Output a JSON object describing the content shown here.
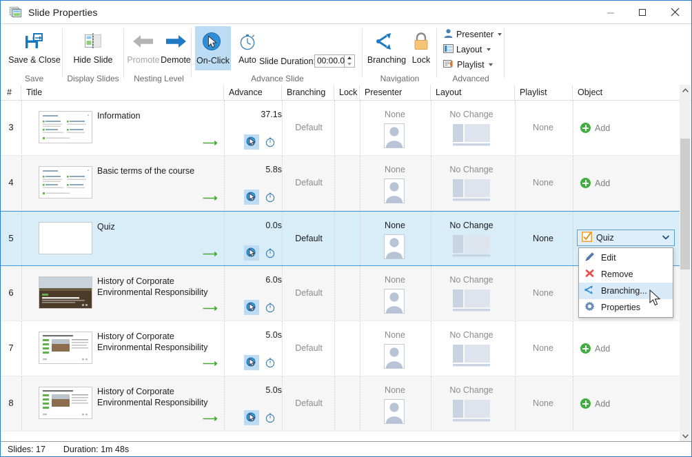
{
  "window": {
    "title": "Slide Properties",
    "icon": "slides-icon",
    "minimize": "minimize-button",
    "maximize": "maximize-button",
    "close": "close-button"
  },
  "ribbon": {
    "groups": [
      {
        "name": "Save",
        "label": "Save"
      },
      {
        "name": "Display Slides",
        "label": "Display Slides"
      },
      {
        "name": "Nesting Level",
        "label": "Nesting Level"
      },
      {
        "name": "Advance Slide",
        "label": "Advance Slide"
      },
      {
        "name": "Navigation",
        "label": "Navigation"
      },
      {
        "name": "Advanced",
        "label": "Advanced"
      }
    ],
    "save_close": "Save & Close",
    "hide_slide": "Hide Slide",
    "promote": "Promote",
    "demote": "Demote",
    "on_click": "On-Click",
    "auto": "Auto",
    "duration_label": "Slide Duration:",
    "duration_value": "00:00.00",
    "branching": "Branching",
    "lock": "Lock",
    "presenter": "Presenter",
    "layout": "Layout",
    "playlist": "Playlist"
  },
  "grid": {
    "columns": [
      {
        "key": "num",
        "label": "#"
      },
      {
        "key": "title",
        "label": "Title"
      },
      {
        "key": "advance",
        "label": "Advance"
      },
      {
        "key": "branching",
        "label": "Branching"
      },
      {
        "key": "lock",
        "label": "Lock"
      },
      {
        "key": "presenter",
        "label": "Presenter"
      },
      {
        "key": "layout",
        "label": "Layout"
      },
      {
        "key": "playlist",
        "label": "Playlist"
      },
      {
        "key": "object",
        "label": "Object"
      }
    ],
    "rows": [
      {
        "num": "3",
        "title": "Information",
        "duration": "37.1s",
        "branching": "Default",
        "presenter": "None",
        "layout": "No Change",
        "playlist": "None",
        "object": "Add",
        "thumb": "text-slide",
        "advance_mode": "on-click"
      },
      {
        "num": "4",
        "title": "Basic terms of the course",
        "duration": "5.8s",
        "branching": "Default",
        "presenter": "None",
        "layout": "No Change",
        "playlist": "None",
        "object": "Add",
        "thumb": "text-slide",
        "advance_mode": "on-click"
      },
      {
        "num": "5",
        "title": "Quiz",
        "duration": "0.0s",
        "branching": "Default",
        "presenter": "None",
        "layout": "No Change",
        "playlist": "None",
        "object": "Quiz",
        "thumb": "blank-slide",
        "advance_mode": "on-click",
        "selected": true
      },
      {
        "num": "6",
        "title": "History of Corporate Environmental Responsibility",
        "duration": "6.0s",
        "branching": "Default",
        "presenter": "None",
        "layout": "No Change",
        "playlist": "None",
        "object": "Add",
        "thumb": "photo-slide",
        "advance_mode": "on-click"
      },
      {
        "num": "7",
        "title": "History of Corporate Environmental Responsibility",
        "duration": "5.0s",
        "branching": "Default",
        "presenter": "None",
        "layout": "No Change",
        "playlist": "None",
        "object": "Add",
        "thumb": "mixed-slide",
        "advance_mode": "on-click"
      },
      {
        "num": "8",
        "title": "History of Corporate Environmental Responsibility",
        "duration": "5.0s",
        "branching": "Default",
        "presenter": "None",
        "layout": "No Change",
        "playlist": "None",
        "object": "Add",
        "thumb": "mixed-slide",
        "advance_mode": "on-click"
      }
    ]
  },
  "object_dropdown": {
    "selected": "Quiz",
    "items": [
      {
        "label": "Edit",
        "icon": "pencil-icon"
      },
      {
        "label": "Remove",
        "icon": "x-mark-icon"
      },
      {
        "label": "Branching...",
        "icon": "branching-icon",
        "hovered": true
      },
      {
        "label": "Properties",
        "icon": "gear-icon"
      }
    ]
  },
  "status": {
    "slides_label": "Slides: 17",
    "duration_label": "Duration:  1m 48s"
  },
  "colors": {
    "accent": "#2b7cd3",
    "selection": "#d9edf9",
    "ribbon_active": "#bcdcf4",
    "green": "#45a832",
    "orange": "#f0a32e"
  }
}
